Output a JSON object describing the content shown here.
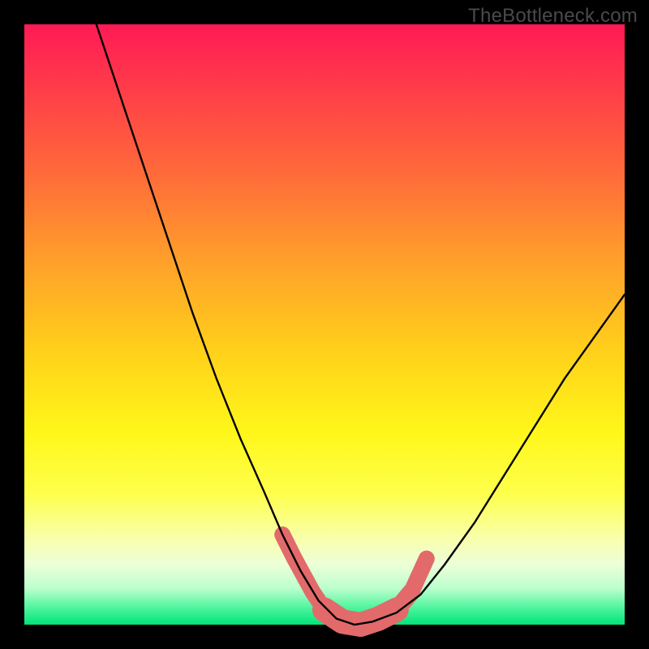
{
  "watermark": "TheBottleneck.com",
  "chart_data": {
    "type": "line",
    "title": "",
    "xlabel": "",
    "ylabel": "",
    "xlim": [
      0,
      100
    ],
    "ylim": [
      0,
      100
    ],
    "series": [
      {
        "name": "bottleneck-curve",
        "x": [
          12,
          16,
          20,
          24,
          28,
          32,
          36,
          40,
          43,
          46,
          49,
          52,
          55,
          58,
          62,
          66,
          70,
          75,
          80,
          85,
          90,
          95,
          100
        ],
        "values": [
          100,
          88,
          76,
          64,
          52,
          41,
          31,
          22,
          15,
          9,
          4,
          1,
          0,
          0.5,
          2,
          5,
          10,
          17,
          25,
          33,
          41,
          48,
          55
        ]
      }
    ],
    "highlight_band": {
      "points": [
        {
          "x": 43,
          "y": 15
        },
        {
          "x": 45,
          "y": 11
        },
        {
          "x": 48,
          "y": 5.5
        },
        {
          "x": 50,
          "y": 2.5
        },
        {
          "x": 53,
          "y": 0.5
        },
        {
          "x": 56,
          "y": 0
        },
        {
          "x": 59,
          "y": 1
        },
        {
          "x": 62,
          "y": 2.5
        },
        {
          "x": 64.5,
          "y": 5.5
        },
        {
          "x": 67,
          "y": 11
        }
      ],
      "segments": [
        {
          "from": 0,
          "to": 3,
          "width": 20
        },
        {
          "from": 3,
          "to": 7,
          "width": 30
        },
        {
          "from": 7,
          "to": 8,
          "width": 22
        },
        {
          "from": 8,
          "to": 9,
          "width": 20
        }
      ],
      "gap_between": [
        7,
        8
      ],
      "color": "#e26a6a"
    },
    "colors": {
      "curve": "#000000",
      "highlight": "#e26a6a",
      "frame": "#000000"
    }
  }
}
